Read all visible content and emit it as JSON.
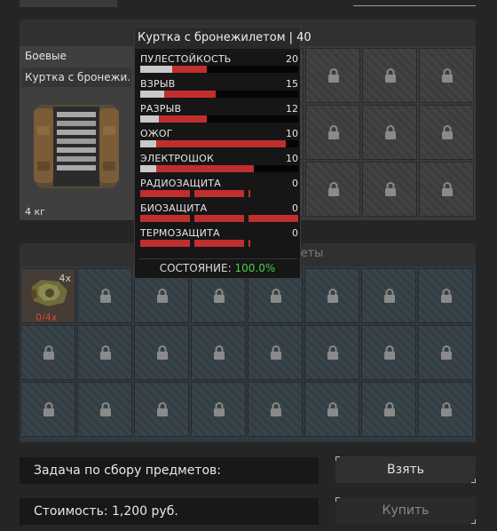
{
  "item": {
    "category": "Боевые",
    "name": "Куртка с бронежи..",
    "weight": "4 кг",
    "icon": "armored-jacket-icon"
  },
  "tooltip": {
    "title": "Куртка с бронежилетом",
    "level": "40",
    "stats": [
      {
        "name": "ПУЛЕСТОЙКОСТЬ",
        "value": "20",
        "base": 0.2,
        "fill": 0.42
      },
      {
        "name": "ВЗРЫВ",
        "value": "15",
        "base": 0.15,
        "fill": 0.48
      },
      {
        "name": "РАЗРЫВ",
        "value": "12",
        "base": 0.12,
        "fill": 0.42
      },
      {
        "name": "ОЖОГ",
        "value": "10",
        "base": 0.1,
        "fill": 0.92
      },
      {
        "name": "ЭЛЕКТРОШОК",
        "value": "10",
        "base": 0.1,
        "fill": 0.72
      },
      {
        "name": "РАДИОЗАЩИТА",
        "value": "0",
        "segments": 2
      },
      {
        "name": "БИОЗАЩИТА",
        "value": "0",
        "segments": 3
      },
      {
        "name": "ТЕРМОЗАЩИТА",
        "value": "0",
        "segments": 2
      }
    ],
    "condition_label": "СОСТОЯНИЕ:",
    "condition_value": "100.0%"
  },
  "required": {
    "title": "Необходимые предметы",
    "item_count": "4x",
    "item_progress": "0/4x",
    "item_icon": "scrap-material-icon"
  },
  "task": {
    "label": "Задача по сбору предметов:"
  },
  "cost": {
    "label": "Стоимость: 1,200 руб."
  },
  "buttons": {
    "take": "Взять",
    "buy": "Купить"
  },
  "colors": {
    "stat_bar": "#c12e2e",
    "condition_ok": "#4dd04d",
    "progress_missing": "#d0483c"
  }
}
